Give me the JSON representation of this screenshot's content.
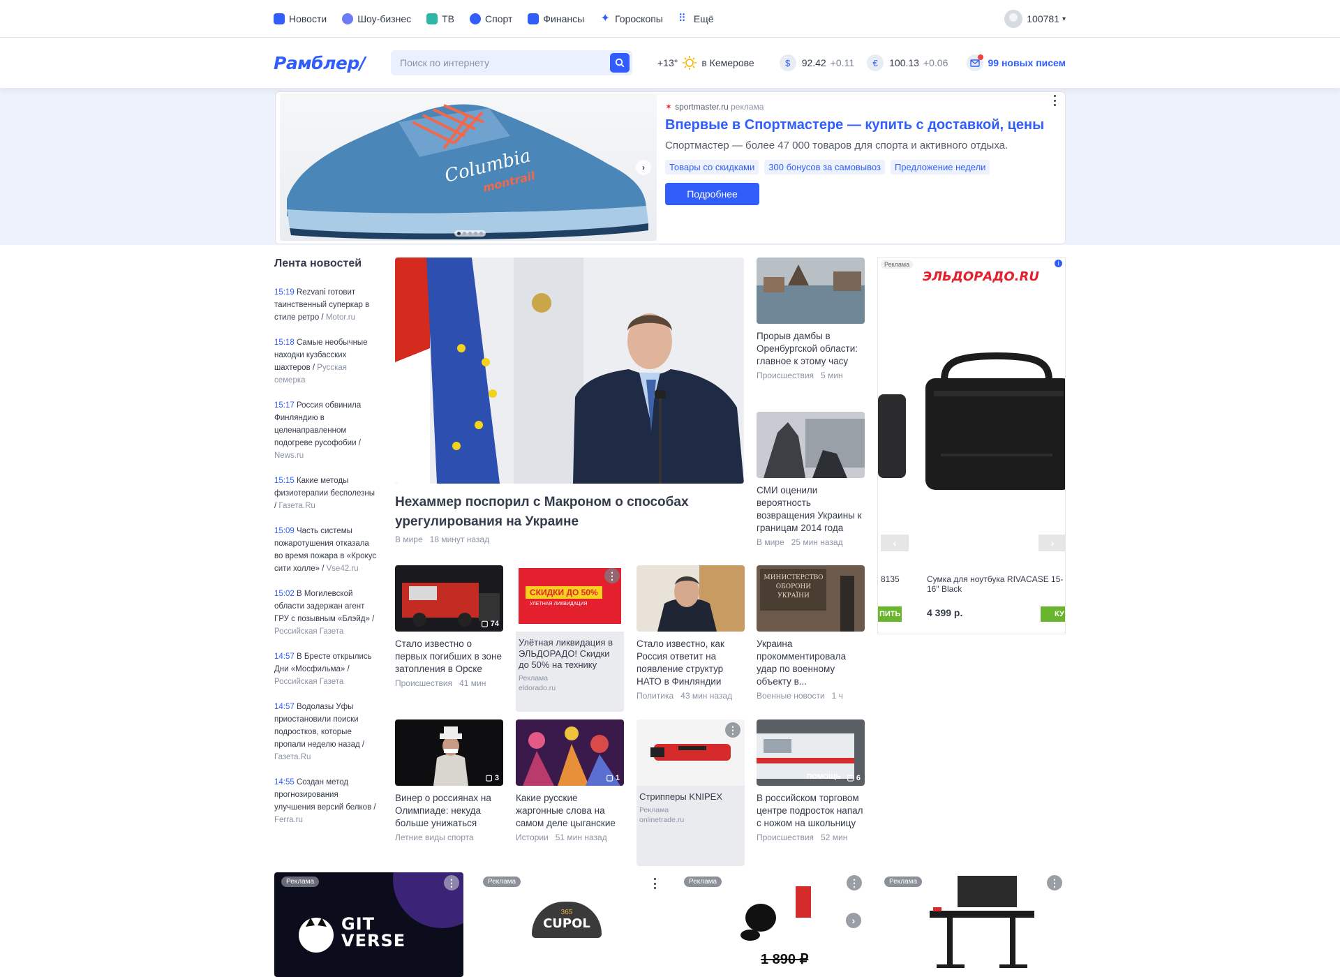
{
  "topnav": {
    "items": [
      {
        "label": "Новости",
        "color": "#315efb"
      },
      {
        "label": "Шоу-бизнес",
        "color": "#6a7bf5"
      },
      {
        "label": "ТВ",
        "color": "#2eb6a8"
      },
      {
        "label": "Спорт",
        "color": "#315efb"
      },
      {
        "label": "Финансы",
        "color": "#315efb"
      },
      {
        "label": "Гороскопы",
        "color": "#315efb"
      },
      {
        "label": "Ещё",
        "color": "#315efb"
      }
    ],
    "user": "100781"
  },
  "header": {
    "logo": "Рамблер/",
    "search_placeholder": "Поиск по интернету",
    "temperature": "+13°",
    "city": "в Кемерове",
    "usd_symbol": "$",
    "usd_value": "92.42",
    "usd_delta": "+0.11",
    "eur_symbol": "€",
    "eur_value": "100.13",
    "eur_delta": "+0.06",
    "mail": "99 новых писем"
  },
  "ad_banner": {
    "source": "sportmaster.ru",
    "source_label": "реклама",
    "title": "Впервые в Спортмастере — купить с доставкой, цены",
    "description": "Спортмастер — более 47 000 товаров для спорта и активного отдыха.",
    "tags": [
      "Товары со скидками",
      "300 бонусов за самовывоз",
      "Предложение недели"
    ],
    "button": "Подробнее",
    "shoe_brand": "Columbia",
    "shoe_sub": "montrail"
  },
  "feed": {
    "title": "Лента новостей",
    "items": [
      {
        "time": "15:19",
        "text": "Rezvani готовит таинственный суперкар в стиле ретро",
        "source": "Motor.ru"
      },
      {
        "time": "15:18",
        "text": "Самые необычные находки кузбасских шахтеров",
        "source": "Русская семерка"
      },
      {
        "time": "15:17",
        "text": "Россия обвинила Финляндию в целенаправленном подогреве русофобии",
        "source": "News.ru"
      },
      {
        "time": "15:15",
        "text": "Какие методы физиотерапии бесполезны",
        "source": "Газета.Ru"
      },
      {
        "time": "15:09",
        "text": "Часть системы пожаротушения отказала во время пожара в «Крокус сити холле»",
        "source": "Vse42.ru"
      },
      {
        "time": "15:02",
        "text": "В Могилевской области задержан агент ГРУ с позывным «Блэйд»",
        "source": "Российская Газета"
      },
      {
        "time": "14:57",
        "text": "В Бресте открылись Дни «Мосфильма»",
        "source": "Российская Газета"
      },
      {
        "time": "14:57",
        "text": "Водолазы Уфы приостановили поиски подростков, которые пропали неделю назад",
        "source": "Газета.Ru"
      },
      {
        "time": "14:55",
        "text": "Создан метод прогнозирования улучшения версий белков",
        "source": "Ferra.ru"
      }
    ]
  },
  "hero": {
    "title": "Нехаммер поспорил с Макроном о способах урегулирования на Украине",
    "category": "В мире",
    "time": "18 минут назад"
  },
  "side_news": [
    {
      "title": "Прорыв дамбы в Оренбургской области: главное к этому часу",
      "category": "Происшествия",
      "time": "5 мин"
    },
    {
      "title": "СМИ оценили вероятность возвращения Украины к границам 2014 года",
      "category": "В мире",
      "time": "25 мин назад"
    }
  ],
  "grid": {
    "row1": [
      {
        "title": "Стало известно о первых погибших в зоне затопления в Орске",
        "category": "Происшествия",
        "time": "41 мин",
        "comments": "74"
      },
      {
        "ad": true,
        "title": "Улётная ликвидация в ЭЛЬДОРАДО! Скидки до 50% на технику",
        "label": "Реклама",
        "domain": "eldorado.ru",
        "banner_text": "СКИДКИ ДО 50%",
        "banner_sub": "УЛЕТНАЯ ЛИКВИДАЦИЯ"
      },
      {
        "title": "Стало известно, как Россия ответит на появление структур НАТО в Финляндии",
        "category": "Политика",
        "time": "43 мин назад"
      },
      {
        "title": "Украина прокомментировала удар по военному объекту в...",
        "category": "Военные новости",
        "time": "1 ч",
        "sign_text": "МИНИСТЕРСТВО ОБОРОНИ УКРАЇНИ"
      }
    ],
    "row2": [
      {
        "title": "Винер о россиянах на Олимпиаде: некуда больше унижаться",
        "category": "Летние виды спорта",
        "time": "",
        "comments": "3"
      },
      {
        "title": "Какие русские жаргонные слова на самом деле цыганские",
        "category": "Истории",
        "time": "51 мин назад",
        "comments": "1"
      },
      {
        "ad": true,
        "title": "Стрипперы KNIPEX",
        "label": "Реклама",
        "domain": "onlinetrade.ru"
      },
      {
        "title": "В российском торговом центре подросток напал с ножом на школьницу",
        "category": "Происшествия",
        "time": "52 мин",
        "comments": "6",
        "ambulance_text": "ПОМОЩЬ"
      }
    ]
  },
  "eldorado": {
    "label": "Реклама",
    "logo": "ЭЛЬДОРАДО.RU",
    "prev_id": "8135",
    "prev_btn": "ПИТЬ",
    "product": "Сумка для ноутбука RIVACASE 15-16\" Black",
    "price": "4 399 р.",
    "next_btn": "КУ"
  },
  "bottom_ads": [
    {
      "label": "Реклама",
      "text": "GIT VERSE"
    },
    {
      "label": "Реклама",
      "text": "CUPOL",
      "sub": "365"
    },
    {
      "label": "Реклама",
      "price": "1 890 ₽"
    },
    {
      "label": "Реклама"
    }
  ]
}
